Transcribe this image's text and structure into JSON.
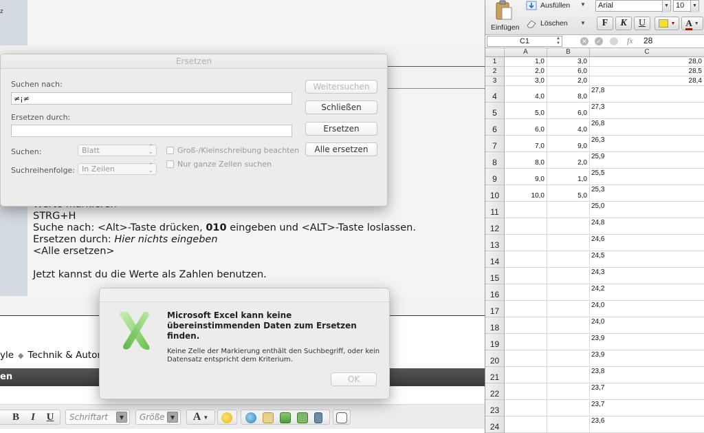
{
  "forum": {
    "top_fragment": "z",
    "post_lines": {
      "l0": "Werte markieren",
      "l1": "STRG+H",
      "l2_a": "Suche nach: <Alt>-Taste drücken, ",
      "l2_b": "010",
      "l2_c": " eingeben und <ALT>-Taste loslassen.",
      "l3_a": "Ersetzen durch: ",
      "l3_b": "Hier nichts eingeben",
      "l4": "<Alle ersetzen>",
      "l5": "Jetzt kannst du die Werte als Zahlen benutzen."
    },
    "breadcrumb": {
      "item1": "yle",
      "item2": "Technik & Automo"
    },
    "darkbar_text": "en",
    "toolbar": {
      "bold": "B",
      "italic": "I",
      "underline": "U",
      "font_placeholder": "Schriftart",
      "size_placeholder": "Größe",
      "color_button": "A"
    }
  },
  "excel": {
    "ribbon": {
      "paste": "Einfügen",
      "fill": "Ausfüllen",
      "clear": "Löschen",
      "font": "Arial",
      "size": "10",
      "bold": "F",
      "italic": "K",
      "underline": "U",
      "font_color": "A"
    },
    "namebox": "C1",
    "fx": "fx",
    "formula_value": "28",
    "columns": [
      "A",
      "B",
      "C"
    ],
    "rows": [
      {
        "n": "1",
        "a": "1,0",
        "b": "3,0",
        "c": "28,0"
      },
      {
        "n": "2",
        "a": "2,0",
        "b": "6,0",
        "c": "28,5"
      },
      {
        "n": "3",
        "a": "3,0",
        "b": "2,0",
        "c": "28,4"
      },
      {
        "n": "4",
        "a": "4,0",
        "b": "8,0",
        "c": "27,8"
      },
      {
        "n": "5",
        "a": "5,0",
        "b": "6,0",
        "c": "27,3"
      },
      {
        "n": "6",
        "a": "6,0",
        "b": "4,0",
        "c": "26,8"
      },
      {
        "n": "7",
        "a": "7,0",
        "b": "9,0",
        "c": "26,3"
      },
      {
        "n": "8",
        "a": "8,0",
        "b": "2,0",
        "c": "25,9"
      },
      {
        "n": "9",
        "a": "9,0",
        "b": "1,0",
        "c": "25,5"
      },
      {
        "n": "10",
        "a": "10,0",
        "b": "5,0",
        "c": "25,3"
      },
      {
        "n": "11",
        "a": "",
        "b": "",
        "c": "25,0"
      },
      {
        "n": "12",
        "a": "",
        "b": "",
        "c": "24,8"
      },
      {
        "n": "13",
        "a": "",
        "b": "",
        "c": "24,6"
      },
      {
        "n": "14",
        "a": "",
        "b": "",
        "c": "24,5"
      },
      {
        "n": "15",
        "a": "",
        "b": "",
        "c": "24,3"
      },
      {
        "n": "16",
        "a": "",
        "b": "",
        "c": "24,2"
      },
      {
        "n": "17",
        "a": "",
        "b": "",
        "c": "24,0"
      },
      {
        "n": "18",
        "a": "",
        "b": "",
        "c": "24,0"
      },
      {
        "n": "19",
        "a": "",
        "b": "",
        "c": "23,9"
      },
      {
        "n": "20",
        "a": "",
        "b": "",
        "c": "23,9"
      },
      {
        "n": "21",
        "a": "",
        "b": "",
        "c": "23,8"
      },
      {
        "n": "22",
        "a": "",
        "b": "",
        "c": "23,7"
      },
      {
        "n": "23",
        "a": "",
        "b": "",
        "c": "23,7"
      },
      {
        "n": "24",
        "a": "",
        "b": "",
        "c": "23,6"
      }
    ]
  },
  "replace_dialog": {
    "title": "Ersetzen",
    "search_label": "Suchen nach:",
    "search_value": "≠¡≠",
    "replace_label": "Ersetzen durch:",
    "replace_value": "",
    "scope_label": "Suchen:",
    "scope_value": "Blatt",
    "order_label": "Suchreihenfolge:",
    "order_value": "In Zeilen",
    "case_label": "Groß-/Kleinschreibung beachten",
    "whole_label": "Nur ganze Zellen suchen",
    "btn_find_next": "Weitersuchen",
    "btn_close": "Schließen",
    "btn_replace": "Ersetzen",
    "btn_replace_all": "Alle ersetzen"
  },
  "alert": {
    "message": "Microsoft Excel kann keine übereinstimmenden Daten zum Ersetzen finden.",
    "info": "Keine Zelle der Markierung enthält den Suchbegriff, oder kein Datensatz entspricht dem Kriterium.",
    "ok": "OK"
  }
}
